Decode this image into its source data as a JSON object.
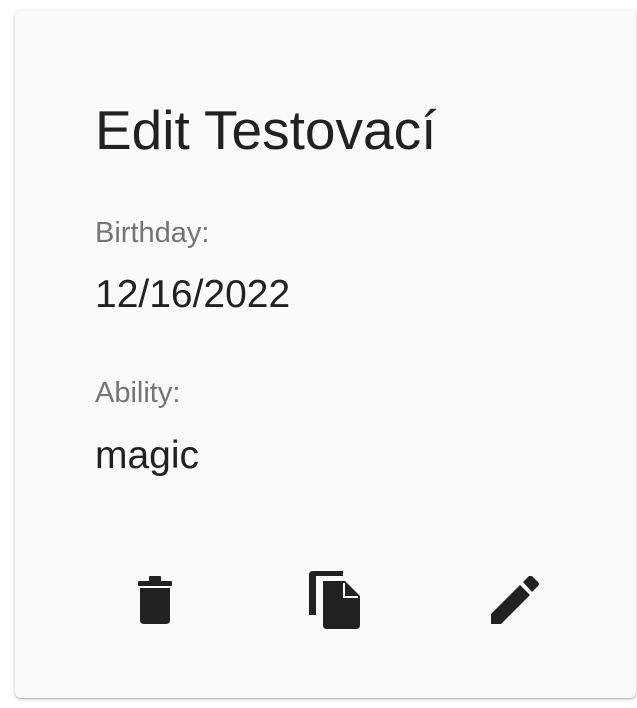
{
  "card": {
    "title": "Edit Testovací",
    "fields": {
      "birthday": {
        "label": "Birthday:",
        "value": "12/16/2022"
      },
      "ability": {
        "label": "Ability:",
        "value": "magic"
      }
    },
    "actions": {
      "delete_icon": "delete-icon",
      "copy_icon": "file-copy-icon",
      "edit_icon": "pencil-icon"
    }
  },
  "colors": {
    "card_background": "#fafafa",
    "text_primary": "#212121",
    "text_secondary": "#757575",
    "icon": "#212121"
  }
}
